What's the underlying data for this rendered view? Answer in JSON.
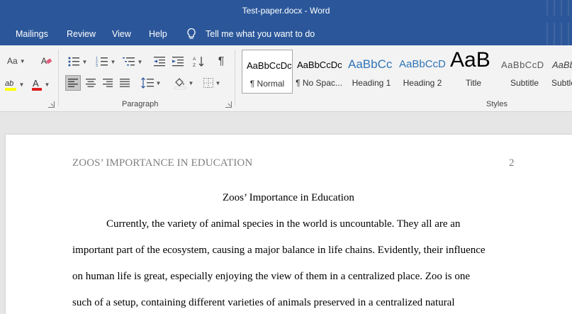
{
  "window": {
    "title": "Test-paper.docx  -  Word"
  },
  "menu": {
    "items": [
      "Mailings",
      "Review",
      "View",
      "Help"
    ],
    "tell_me": "Tell me what you want to do"
  },
  "ribbon": {
    "font_size_label": "Aa",
    "paragraph_group_label": "Paragraph",
    "styles_group_label": "Styles",
    "styles": [
      {
        "preview": "AaBbCcDc",
        "name": "¶ Normal"
      },
      {
        "preview": "AaBbCcDc",
        "name": "¶ No Spac..."
      },
      {
        "preview": "AaBbCc",
        "name": "Heading 1"
      },
      {
        "preview": "AaBbCcD",
        "name": "Heading 2"
      },
      {
        "preview": "AaB",
        "name": "Title"
      },
      {
        "preview": "AaBbCcD",
        "name": "Subtitle"
      },
      {
        "preview": "AaBbC",
        "name": "Subtle"
      }
    ]
  },
  "document": {
    "running_header": "ZOOS’ IMPORTANCE IN EDUCATION",
    "page_number": "2",
    "title": "Zoos’ Importance in Education",
    "lines": [
      "Currently, the variety of animal species in the world is uncountable. They all are an",
      "important part of the ecosystem, causing a major balance in life chains. Evidently, their influence",
      "on human life is great, especially enjoying the view of them in a centralized place. Zoo is one",
      "such of a setup, containing different varieties of animals preserved in a centralized natural"
    ]
  },
  "colors": {
    "word_blue": "#2b579a",
    "ribbon_bg": "#f3f3f3",
    "heading_blue": "#2e74b5",
    "header_gray": "#7f7f7f"
  }
}
